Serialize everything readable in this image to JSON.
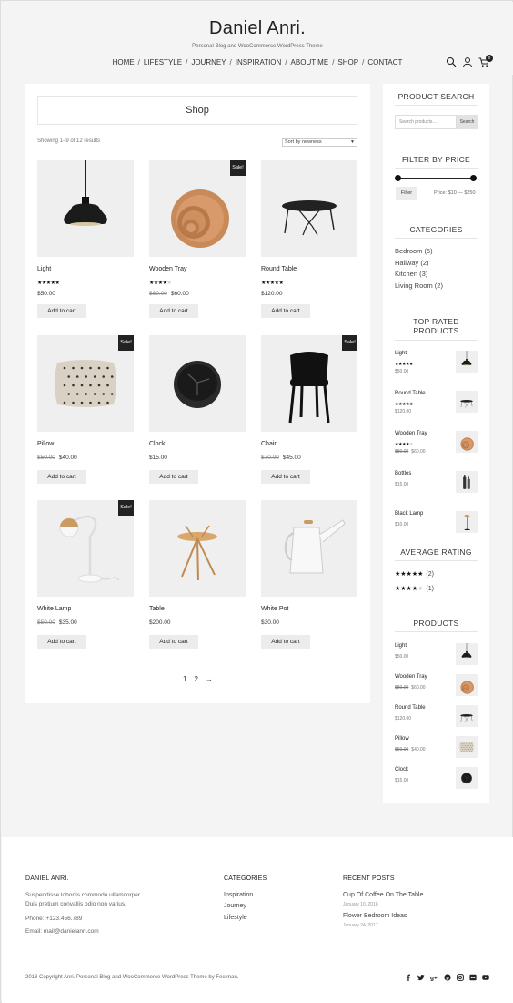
{
  "header": {
    "title": "Daniel Anri.",
    "tagline": "Personal Blog and WooCommerce WordPress Theme",
    "nav": [
      "HOME",
      "LIFESTYLE",
      "JOURNEY",
      "INSPIRATION",
      "ABOUT ME",
      "SHOP",
      "CONTACT"
    ],
    "cart_count": "0"
  },
  "main": {
    "page_title": "Shop",
    "result_count": "Showing 1–9 of 12 results",
    "ordering": "Sort by newness",
    "products": [
      {
        "name": "Light",
        "rating": 5,
        "price": "$50.00",
        "old_price": "",
        "sale": "",
        "button": "Add to cart",
        "icon": "pendant-lamp"
      },
      {
        "name": "Wooden Tray",
        "rating": 4,
        "price": "$60.00",
        "old_price": "$80.00",
        "sale": "Sale!",
        "button": "Add to cart",
        "icon": "wooden-tray"
      },
      {
        "name": "Round Table",
        "rating": 5,
        "price": "$120.00",
        "old_price": "",
        "sale": "",
        "button": "Add to cart",
        "icon": "round-table"
      },
      {
        "name": "Pillow",
        "rating": 0,
        "price": "$40.00",
        "old_price": "$50.00",
        "sale": "Sale!",
        "button": "Add to cart",
        "icon": "pillow"
      },
      {
        "name": "Clock",
        "rating": 0,
        "price": "$15.00",
        "old_price": "",
        "sale": "",
        "button": "Add to cart",
        "icon": "clock"
      },
      {
        "name": "Chair",
        "rating": 0,
        "price": "$45.00",
        "old_price": "$70.00",
        "sale": "Sale!",
        "button": "Add to cart",
        "icon": "chair"
      },
      {
        "name": "White Lamp",
        "rating": 0,
        "price": "$35.00",
        "old_price": "$50.00",
        "sale": "Sale!",
        "button": "Add to cart",
        "icon": "white-lamp"
      },
      {
        "name": "Table",
        "rating": 0,
        "price": "$200.00",
        "old_price": "",
        "sale": "",
        "button": "Add to cart",
        "icon": "side-table"
      },
      {
        "name": "White Pot",
        "rating": 0,
        "price": "$30.00",
        "old_price": "",
        "sale": "",
        "button": "Add to cart",
        "icon": "white-pot"
      }
    ],
    "pagination": [
      "1",
      "2",
      "→"
    ]
  },
  "sidebar": {
    "search_title": "PRODUCT SEARCH",
    "search_placeholder": "Search products…",
    "search_button": "Search",
    "price_title": "FILTER BY PRICE",
    "filter_button": "Filter",
    "price_range": "Price: $10 — $250",
    "categories_title": "CATEGORIES",
    "categories": [
      "Bedroom (5)",
      "Hallway (2)",
      "Kitchen (3)",
      "Living Room (2)"
    ],
    "top_rated_title": "TOP RATED PRODUCTS",
    "top_rated": [
      {
        "name": "Light",
        "rating": 5,
        "price": "$50.00",
        "old_price": "",
        "icon": "pendant-lamp"
      },
      {
        "name": "Round Table",
        "rating": 5,
        "price": "$120.00",
        "old_price": "",
        "icon": "round-table"
      },
      {
        "name": "Wooden Tray",
        "rating": 4,
        "price": "$60.00",
        "old_price": "$80.00",
        "icon": "wooden-tray"
      },
      {
        "name": "Bottles",
        "rating": 0,
        "price": "$15.00",
        "old_price": "",
        "icon": "bottles"
      },
      {
        "name": "Black Lamp",
        "rating": 0,
        "price": "$10.00",
        "old_price": "",
        "icon": "black-lamp"
      }
    ],
    "avg_rating_title": "AVERAGE RATING",
    "avg_ratings": [
      {
        "stars": 5,
        "count": "(2)"
      },
      {
        "stars": 4,
        "count": "(1)"
      }
    ],
    "products_title": "PRODUCTS",
    "products": [
      {
        "name": "Light",
        "price": "$50.00",
        "old_price": "",
        "icon": "pendant-lamp"
      },
      {
        "name": "Wooden Tray",
        "price": "$60.00",
        "old_price": "$80.00",
        "icon": "wooden-tray"
      },
      {
        "name": "Round Table",
        "price": "$120.00",
        "old_price": "",
        "icon": "round-table"
      },
      {
        "name": "Pillow",
        "price": "$40.00",
        "old_price": "$50.00",
        "icon": "pillow"
      },
      {
        "name": "Clock",
        "price": "$15.00",
        "old_price": "",
        "icon": "clock"
      }
    ]
  },
  "footer": {
    "about_title": "DANIEL ANRI.",
    "about_text_1": "Suspendisse lobortis commodo ullamcorper.",
    "about_text_2": "Duis pretium convallis odio non varius.",
    "phone": "Phone: +123.456.789",
    "email": "Email: mail@danielanri.com",
    "categories_title": "CATEGORIES",
    "categories": [
      "Inspiration",
      "Journey",
      "Lifestyle"
    ],
    "recent_title": "RECENT POSTS",
    "recent_posts": [
      {
        "title": "Cup Of Coffee On The Table",
        "date": "January 10, 2018"
      },
      {
        "title": "Flower Bedroom Ideas",
        "date": "January 24, 2017"
      }
    ],
    "copyright": "2018 Copyright Anri. Personal Blog and WooCommerce WordPress Theme by Feelman.",
    "social_icons": [
      "facebook-icon",
      "twitter-icon",
      "google-plus-icon",
      "pinterest-icon",
      "instagram-icon",
      "flickr-icon",
      "youtube-icon"
    ]
  }
}
